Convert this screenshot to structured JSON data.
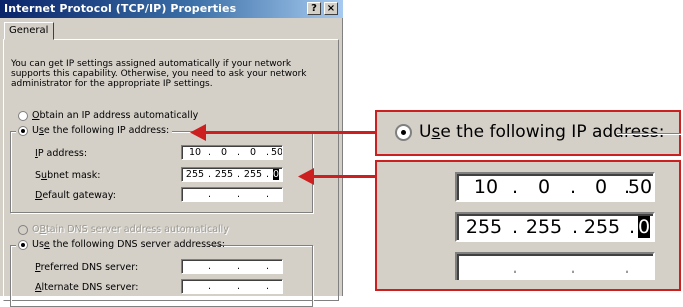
{
  "window": {
    "title": "Internet Protocol (TCP/IP) Properties",
    "help_glyph": "?",
    "close_glyph": "×"
  },
  "tabs": [
    {
      "label": "General"
    }
  ],
  "intro_text": "You can get IP settings assigned automatically if your network supports this capability. Otherwise, you need to ask your network administrator for the appropriate IP settings.",
  "ip_mode": {
    "auto_label_key": "O",
    "auto_label_rest": "btain an IP address automatically",
    "manual_label_pre": "U",
    "manual_label_key": "s",
    "manual_label_rest": "e the following IP address:",
    "selected": "manual"
  },
  "ip_fields": {
    "ip_label_key": "I",
    "ip_label_rest": "P address:",
    "ip_value": [
      "10",
      "0",
      "0",
      "50"
    ],
    "mask_label_pre": "S",
    "mask_label_key": "u",
    "mask_label_rest": "bnet mask:",
    "mask_value": [
      "255",
      "255",
      "255",
      "0"
    ],
    "gateway_label_key": "D",
    "gateway_label_rest": "efault gateway:",
    "separator": "."
  },
  "dns_mode": {
    "auto_label_key": "B",
    "auto_label_rest": "tain DNS server address automatically",
    "auto_label_pre": "O",
    "manual_label_pre": "Us",
    "manual_label_key": "e",
    "manual_label_rest": " the following DNS server addresses:",
    "selected": "manual"
  },
  "dns_fields": {
    "preferred_label_key": "P",
    "preferred_label_rest": "referred DNS server:",
    "alternate_label_key": "A",
    "alternate_label_rest": "lternate DNS server:"
  },
  "zoom_manual": {
    "label_pre": "U",
    "label_key": "s",
    "label_rest": "e the following IP address:"
  },
  "zoom_fields": {
    "ip_value": [
      "10",
      "0",
      "0",
      "50"
    ],
    "mask_value": [
      "255",
      "255",
      "255",
      "0"
    ]
  },
  "colors": {
    "callout": "#cc1f1f",
    "titlebar_start": "#0a246a",
    "titlebar_end": "#a6caf0",
    "face": "#d4d0c8"
  }
}
